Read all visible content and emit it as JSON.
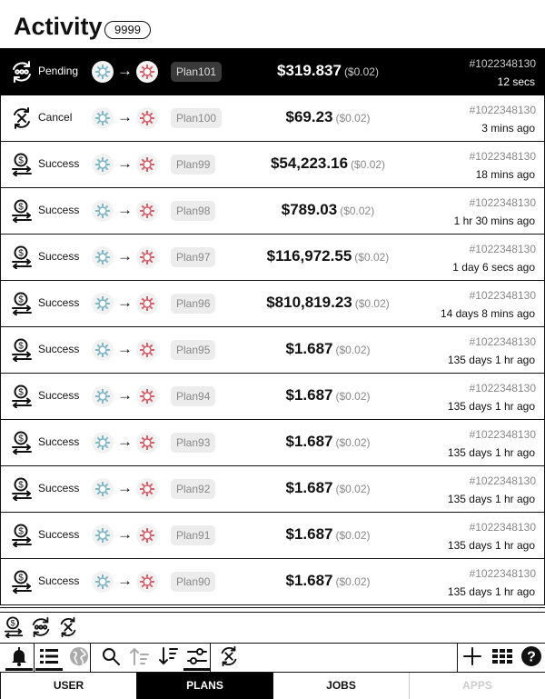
{
  "header": {
    "title": "Activity",
    "count": "9999"
  },
  "rows": [
    {
      "status": "Pending",
      "icon": "pending",
      "plan": "Plan101",
      "amount": "$319.837",
      "fee": "($0.02)",
      "tx": "#1022348130",
      "time": "12 secs",
      "active": true
    },
    {
      "status": "Cancel",
      "icon": "cancel",
      "plan": "Plan100",
      "amount": "$69.23",
      "fee": "($0.02)",
      "tx": "#1022348130",
      "time": "3 mins ago"
    },
    {
      "status": "Success",
      "icon": "success",
      "plan": "Plan99",
      "amount": "$54,223.16",
      "fee": "($0.02)",
      "tx": "#1022348130",
      "time": "18 mins ago"
    },
    {
      "status": "Success",
      "icon": "success",
      "plan": "Plan98",
      "amount": "$789.03",
      "fee": "($0.02)",
      "tx": "#1022348130",
      "time": "1 hr 30 mins ago"
    },
    {
      "status": "Success",
      "icon": "success",
      "plan": "Plan97",
      "amount": "$116,972.55",
      "fee": "($0.02)",
      "tx": "#1022348130",
      "time": "1 day 6 secs ago"
    },
    {
      "status": "Success",
      "icon": "success",
      "plan": "Plan96",
      "amount": "$810,819.23",
      "fee": "($0.02)",
      "tx": "#1022348130",
      "time": "14 days 8 mins ago"
    },
    {
      "status": "Success",
      "icon": "success",
      "plan": "Plan95",
      "amount": "$1.687",
      "fee": "($0.02)",
      "tx": "#1022348130",
      "time": "135 days 1 hr ago"
    },
    {
      "status": "Success",
      "icon": "success",
      "plan": "Plan94",
      "amount": "$1.687",
      "fee": "($0.02)",
      "tx": "#1022348130",
      "time": "135 days 1 hr ago"
    },
    {
      "status": "Success",
      "icon": "success",
      "plan": "Plan93",
      "amount": "$1.687",
      "fee": "($0.02)",
      "tx": "#1022348130",
      "time": "135 days 1 hr ago"
    },
    {
      "status": "Success",
      "icon": "success",
      "plan": "Plan92",
      "amount": "$1.687",
      "fee": "($0.02)",
      "tx": "#1022348130",
      "time": "135 days 1 hr ago"
    },
    {
      "status": "Success",
      "icon": "success",
      "plan": "Plan91",
      "amount": "$1.687",
      "fee": "($0.02)",
      "tx": "#1022348130",
      "time": "135 days 1 hr ago"
    },
    {
      "status": "Success",
      "icon": "success",
      "plan": "Plan90",
      "amount": "$1.687",
      "fee": "($0.02)",
      "tx": "#1022348130",
      "time": "135 days 1 hr ago"
    }
  ],
  "filters": [
    {
      "name": "filter-success-icon",
      "icon": "success"
    },
    {
      "name": "filter-pending-icon",
      "icon": "pending"
    },
    {
      "name": "filter-cancel-icon",
      "icon": "cancel"
    }
  ],
  "toolbar": [
    {
      "name": "notifications-bell-icon",
      "icon": "bell",
      "selected": true
    },
    {
      "name": "list-view-icon",
      "icon": "list",
      "selected": true
    },
    {
      "name": "globe-icon",
      "icon": "globe",
      "disabled": true
    },
    {
      "name": "search-icon",
      "icon": "search"
    },
    {
      "name": "sort-ascending-icon",
      "icon": "sortup",
      "disabled": true
    },
    {
      "name": "sort-descending-icon",
      "icon": "sortdown"
    },
    {
      "name": "filter-sliders-icon",
      "icon": "sliders",
      "selected": true
    },
    {
      "name": "cancel-filter-icon",
      "icon": "cancel"
    },
    {
      "name": "add-icon",
      "icon": "plus"
    },
    {
      "name": "grid-view-icon",
      "icon": "grid"
    },
    {
      "name": "help-icon",
      "icon": "help"
    }
  ],
  "tabs": [
    {
      "label": "USER"
    },
    {
      "label": "PLANS",
      "selected": true
    },
    {
      "label": "JOBS"
    },
    {
      "label": "APPS",
      "disabled": true
    }
  ],
  "colors": {
    "accent": "#000000",
    "muted": "#888888",
    "coin_source": "#7fb7c9",
    "coin_target": "#d9606a"
  }
}
